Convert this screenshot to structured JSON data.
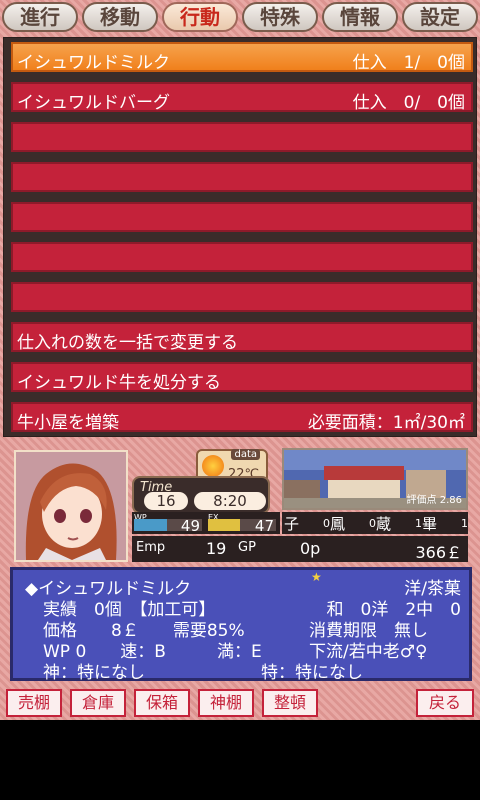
{
  "tabs": [
    {
      "label": "進行"
    },
    {
      "label": "移動"
    },
    {
      "label": "行動"
    },
    {
      "label": "特殊"
    },
    {
      "label": "情報"
    },
    {
      "label": "設定"
    }
  ],
  "active_tab": "行動",
  "list": {
    "rows": [
      {
        "name": "イシュワルドミルク",
        "value": "仕入　1/　0個",
        "selected": true
      },
      {
        "name": "イシュワルドバーグ",
        "value": "仕入　0/　0個",
        "selected": false
      },
      {
        "name": "",
        "value": ""
      },
      {
        "name": "",
        "value": ""
      },
      {
        "name": "",
        "value": ""
      },
      {
        "name": "",
        "value": ""
      },
      {
        "name": "",
        "value": ""
      },
      {
        "name": "仕入れの数を一括で変更する",
        "value": ""
      },
      {
        "name": "イシュワルド牛を処分する",
        "value": ""
      },
      {
        "name": "牛小屋を増築",
        "value": "必要面積：1㎡/30㎡"
      }
    ]
  },
  "status": {
    "weather": {
      "label": "data",
      "temp": "22℃",
      "icon": "sun-icon"
    },
    "time": {
      "label": "Time",
      "day": "16",
      "clock": "8:20"
    },
    "scene_rating": "評価点 2.86",
    "wp": {
      "label": "WP",
      "value": "49",
      "fill": 0.49,
      "color": "#4a9ac8"
    },
    "ex": {
      "label": "EX",
      "value": "47",
      "fill": 0.47,
      "color": "#e0c040"
    },
    "stats": [
      {
        "glyph": "子",
        "value": "0"
      },
      {
        "glyph": "鳳",
        "value": "0"
      },
      {
        "glyph": "蔵",
        "value": "1"
      },
      {
        "glyph": "畢",
        "value": "1"
      }
    ],
    "emp": {
      "label": "Emp",
      "value": "19"
    },
    "gp": {
      "label": "GP",
      "value": "0p"
    },
    "gold": "366￡"
  },
  "item": {
    "name": "◆イシュワルドミルク",
    "category": "洋/茶菓",
    "line2_left": "実績　0個　【加工可】",
    "line2_right": "和　0洋　2中　0",
    "line3_left": "価格　　8￡　　需要85%",
    "line3_right": "消費期限　無し",
    "line4_left": "WP 0　　速：B　　　満：E",
    "line4_right": "下流/若中老♂♀",
    "line5_left": "神：特になし",
    "line5_right": "特：特になし"
  },
  "bottom_buttons": [
    {
      "label": "売棚"
    },
    {
      "label": "倉庫"
    },
    {
      "label": "保箱"
    },
    {
      "label": "神棚"
    },
    {
      "label": "整頓"
    },
    {
      "label": "戻る"
    }
  ]
}
